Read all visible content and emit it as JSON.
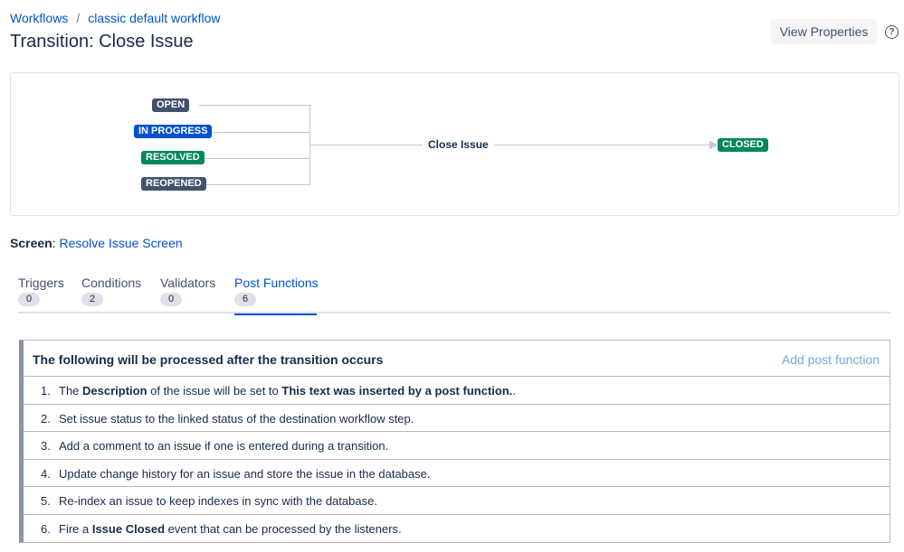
{
  "breadcrumbs": {
    "root": "Workflows",
    "separator": "/",
    "current": "classic default workflow"
  },
  "page_title": "Transition: Close Issue",
  "header": {
    "view_properties_label": "View Properties",
    "help_icon": "?"
  },
  "diagram": {
    "from_statuses": [
      {
        "label": "OPEN",
        "color": "#42526e"
      },
      {
        "label": "IN PROGRESS",
        "color": "#0052cc"
      },
      {
        "label": "RESOLVED",
        "color": "#00875a"
      },
      {
        "label": "REOPENED",
        "color": "#42526e"
      }
    ],
    "transition_label": "Close Issue",
    "to_status": {
      "label": "CLOSED",
      "color": "#00875a"
    }
  },
  "screen": {
    "label": "Screen",
    "colon": ":",
    "value": "Resolve Issue Screen"
  },
  "tabs": [
    {
      "label": "Triggers",
      "count": "0",
      "active": false
    },
    {
      "label": "Conditions",
      "count": "2",
      "active": false
    },
    {
      "label": "Validators",
      "count": "0",
      "active": false
    },
    {
      "label": "Post Functions",
      "count": "6",
      "active": true
    }
  ],
  "post_functions": {
    "heading": "The following will be processed after the transition occurs",
    "add_label": "Add post function",
    "items": [
      {
        "num": "1.",
        "parts": [
          "The ",
          "Description",
          " of the issue will be set to ",
          "This text was inserted by a post function.",
          "."
        ]
      },
      {
        "num": "2.",
        "parts": [
          "Set issue status to the linked status of the destination workflow step."
        ]
      },
      {
        "num": "3.",
        "parts": [
          "Add a comment to an issue if one is entered during a transition."
        ]
      },
      {
        "num": "4.",
        "parts": [
          "Update change history for an issue and store the issue in the database."
        ]
      },
      {
        "num": "5.",
        "parts": [
          "Re-index an issue to keep indexes in sync with the database."
        ]
      },
      {
        "num": "6.",
        "parts": [
          "Fire a ",
          "Issue Closed",
          " event that can be processed by the listeners."
        ]
      }
    ]
  }
}
